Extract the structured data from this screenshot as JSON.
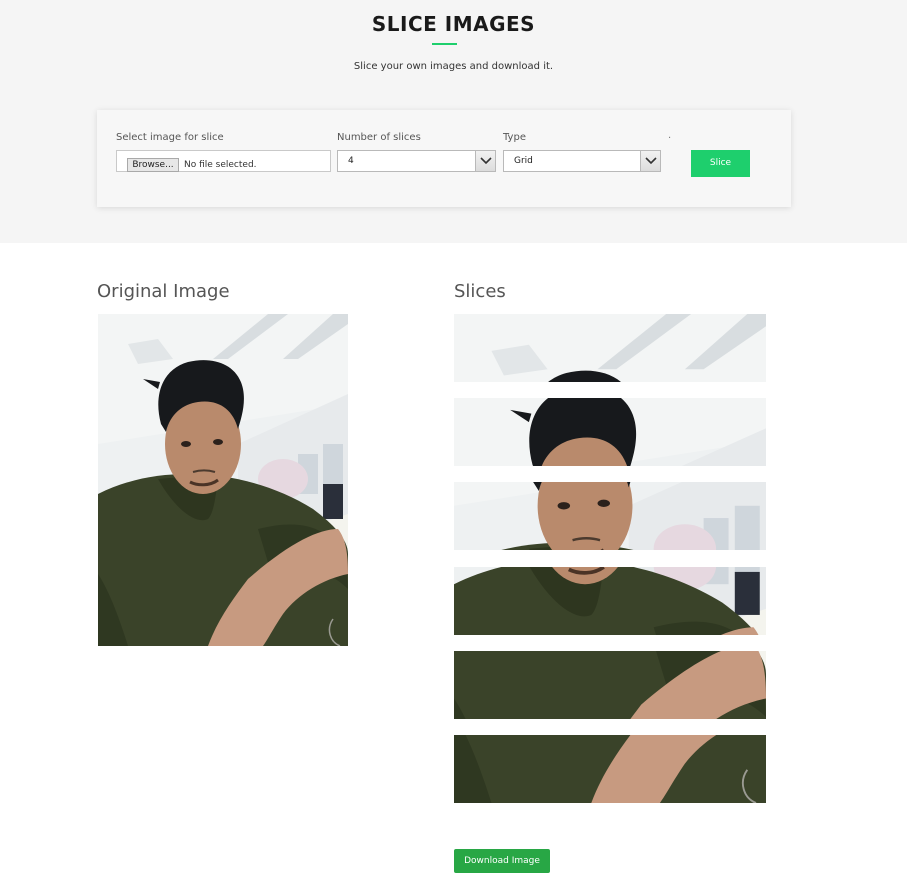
{
  "header": {
    "title": "SLICE IMAGES",
    "subtitle": "Slice your own images and download it."
  },
  "form": {
    "file_label": "Select image for slice",
    "browse_label": "Browse...",
    "file_status": "No file selected.",
    "slices_label": "Number of slices",
    "slices_value": "4",
    "type_label": "Type",
    "type_value": "Grid",
    "dot": ".",
    "slice_button": "Slice"
  },
  "main": {
    "original_title": "Original Image",
    "slices_title": "Slices",
    "slice_count": 6,
    "download_button": "Download Image"
  },
  "colors": {
    "accent": "#1ecf6d",
    "download": "#28a745"
  },
  "icons": [
    "chevron-down-icon"
  ]
}
